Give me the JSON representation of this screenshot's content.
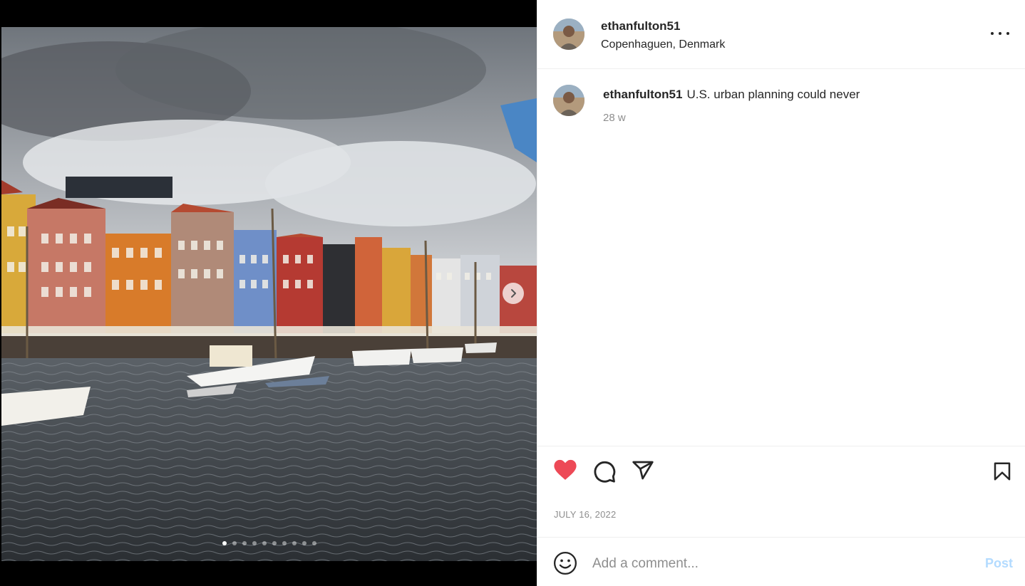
{
  "post": {
    "username": "ethanfulton51",
    "location": "Copenhaguen, Denmark",
    "caption_username": "ethanfulton51",
    "caption_text": "U.S. urban planning could never",
    "age": "28 w",
    "date": "JULY 16, 2022",
    "liked": true,
    "carousel": {
      "total": 10,
      "current": 1
    }
  },
  "comment_box": {
    "placeholder": "Add a comment...",
    "post_label": "Post"
  },
  "icons": {
    "more": "more-horizontal-icon",
    "like": "heart-filled-icon",
    "comment": "comment-bubble-icon",
    "share": "paper-plane-icon",
    "save": "bookmark-icon",
    "emoji": "smiley-icon",
    "next": "chevron-right-icon"
  },
  "colors": {
    "like": "#ed4956",
    "post_disabled": "#b3dbff",
    "secondary_text": "#8e8e8e"
  }
}
